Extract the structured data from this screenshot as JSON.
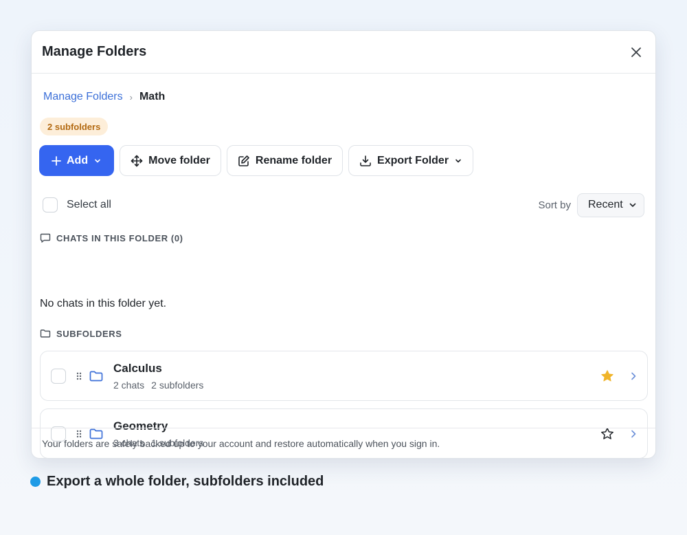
{
  "modal": {
    "title": "Manage Folders",
    "close_icon": "close-icon"
  },
  "breadcrumb": {
    "root": "Manage Folders",
    "separator": "›",
    "current": "Math"
  },
  "badge": "2 subfolders",
  "toolbar": {
    "add": "Add",
    "move": "Move folder",
    "rename": "Rename folder",
    "export": "Export Folder"
  },
  "select_all": "Select all",
  "sort": {
    "label": "Sort by",
    "value": "Recent"
  },
  "chats_section": {
    "heading": "CHATS IN THIS FOLDER (0)",
    "empty": "No chats in this folder yet."
  },
  "subfolders_section": {
    "heading": "SUBFOLDERS",
    "items": [
      {
        "name": "Calculus",
        "chats": "2 chats",
        "subfolders": "2 subfolders",
        "starred": true
      },
      {
        "name": "Geometry",
        "chats": "3 chats",
        "subfolders": "1 subfolders",
        "starred": false
      }
    ]
  },
  "footer": "Your folders are safely backed up to your account and restore automatically when you sign in.",
  "caption": "Export a whole folder, subfolders included",
  "colors": {
    "primary": "#3565f0",
    "link": "#3b6fd8",
    "badge_bg": "#fdeed9",
    "badge_text": "#b36a12",
    "star": "#f0b429",
    "caption_dot": "#1e9be6"
  }
}
